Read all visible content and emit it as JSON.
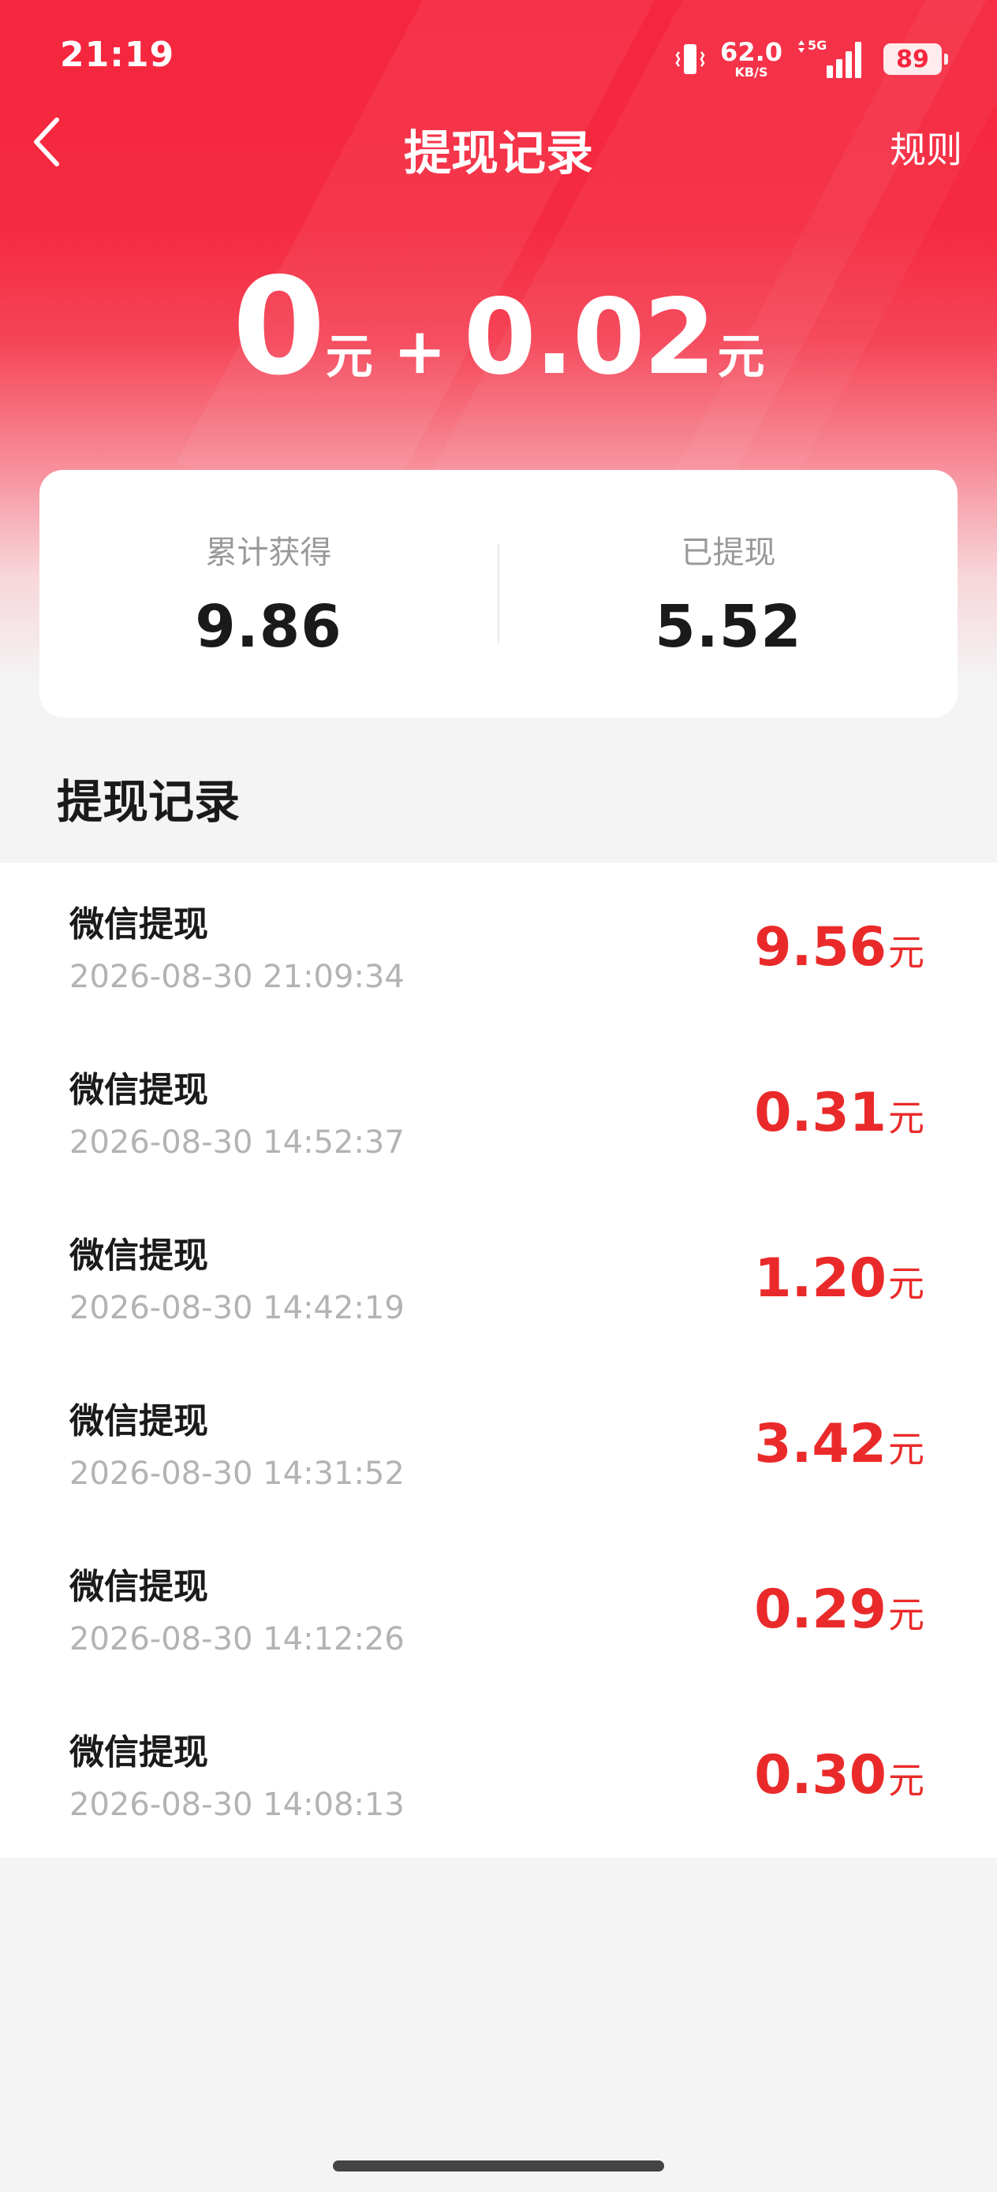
{
  "status_bar": {
    "time": "21:19",
    "net_speed": "62.0",
    "net_speed_unit": "KB/S",
    "network": "5G",
    "battery": "89"
  },
  "nav": {
    "title": "提现记录",
    "rule_label": "规则"
  },
  "balance": {
    "main": "0",
    "main_unit": "元",
    "plus": "+",
    "extra": "0.02",
    "extra_unit": "元"
  },
  "summary": {
    "earned_label": "累计获得",
    "earned_value": "9.86",
    "withdrawn_label": "已提现",
    "withdrawn_value": "5.52"
  },
  "section_title": "提现记录",
  "records": [
    {
      "title": "微信提现",
      "time": "2026-08-30 21:09:34",
      "amount": "9.56",
      "unit": "元"
    },
    {
      "title": "微信提现",
      "time": "2026-08-30 14:52:37",
      "amount": "0.31",
      "unit": "元"
    },
    {
      "title": "微信提现",
      "time": "2026-08-30 14:42:19",
      "amount": "1.20",
      "unit": "元"
    },
    {
      "title": "微信提现",
      "time": "2026-08-30 14:31:52",
      "amount": "3.42",
      "unit": "元"
    },
    {
      "title": "微信提现",
      "time": "2026-08-30 14:12:26",
      "amount": "0.29",
      "unit": "元"
    },
    {
      "title": "微信提现",
      "time": "2026-08-30 14:08:13",
      "amount": "0.30",
      "unit": "元"
    }
  ],
  "colors": {
    "header_red": "#f5263e",
    "amount_red": "#ea2a2a",
    "background": "#f4f4f4"
  },
  "icons": {
    "back": "chevron-left-icon",
    "vibrate": "vibrate-icon",
    "signal": "signal-icon",
    "battery": "battery-icon"
  }
}
